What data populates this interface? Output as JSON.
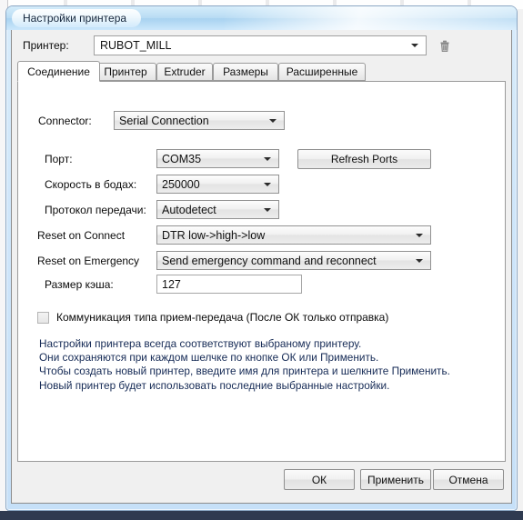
{
  "window": {
    "title": "Настройки принтера"
  },
  "printer_row": {
    "label": "Принтер:",
    "value": "RUBOT_MILL",
    "delete_icon": "trash-icon"
  },
  "tabs": [
    {
      "label": "Соединение",
      "active": true
    },
    {
      "label": "Принтер",
      "active": false
    },
    {
      "label": "Extruder",
      "active": false
    },
    {
      "label": "Размеры",
      "active": false
    },
    {
      "label": "Расширенные",
      "active": false
    }
  ],
  "connection": {
    "connector": {
      "label": "Connector:",
      "value": "Serial Connection"
    },
    "port": {
      "label": "Порт:",
      "value": "COM35"
    },
    "refresh_ports_label": "Refresh Ports",
    "baud": {
      "label": "Скорость в бодах:",
      "value": "250000"
    },
    "protocol": {
      "label": "Протокол передачи:",
      "value": "Autodetect"
    },
    "reset_on_connect": {
      "label": "Reset on Connect",
      "value": "DTR low->high->low"
    },
    "reset_on_emergency": {
      "label": "Reset on Emergency",
      "value": "Send emergency command and reconnect"
    },
    "cache_size": {
      "label": "Размер кэша:",
      "value": "127"
    },
    "comm_checkbox": {
      "label": "Коммуникация типа прием-передача (После ОК только отправка)",
      "checked": false
    },
    "description": [
      "Настройки принтера всегда соответствуют выбраному принтеру.",
      "Они сохраняются при каждом шелчке по кнопке ОК или Применить.",
      "Чтобы создать новый принтер, введите имя для принтера и шелкните Применить.",
      "Новый принтер будет использовать последние выбранные настройки."
    ]
  },
  "footer": {
    "ok_label": "ОК",
    "apply_label": "Применить",
    "cancel_label": "Отмена"
  },
  "colors": {
    "window_frame": "#c6e0f8",
    "client_bg": "#f0f0f0",
    "description_text": "#152a55",
    "accent": "#a8d2f0"
  }
}
